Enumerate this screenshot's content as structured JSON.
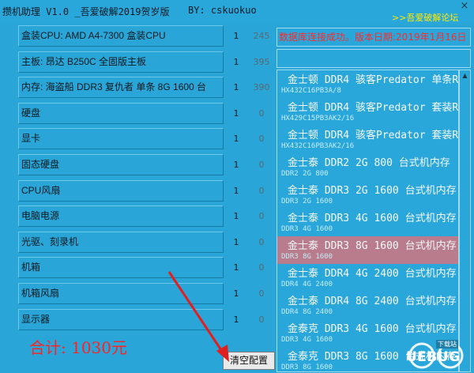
{
  "title": "攒机助理 V1.0 _吾爱破解2019贺岁版",
  "author": "BY: cskuokuo",
  "forum_link": ">>吾爱破解论坛",
  "close": "×",
  "status": "数据库连接成功。版本日期:2019年1月16日",
  "rows": [
    {
      "label": "盒装CPU: AMD A4-7300 盒装CPU",
      "qty": "1",
      "price": "245"
    },
    {
      "label": "主板: 昂达 B250C 全固版主板",
      "qty": "1",
      "price": "395"
    },
    {
      "label": "内存: 海盗船 DDR3 复仇者 单条 8G 1600 台",
      "qty": "1",
      "price": "390"
    },
    {
      "label": "硬盘",
      "qty": "1",
      "price": "0"
    },
    {
      "label": "显卡",
      "qty": "1",
      "price": "0"
    },
    {
      "label": "固态硬盘",
      "qty": "1",
      "price": "0"
    },
    {
      "label": "CPU风扇",
      "qty": "1",
      "price": "0"
    },
    {
      "label": "电脑电源",
      "qty": "1",
      "price": "0"
    },
    {
      "label": "光驱、刻录机",
      "qty": "1",
      "price": "0"
    },
    {
      "label": "机箱",
      "qty": "1",
      "price": "0"
    },
    {
      "label": "机箱风扇",
      "qty": "1",
      "price": "0"
    },
    {
      "label": "显示器",
      "qty": "1",
      "price": "0"
    }
  ],
  "list": [
    {
      "name": "金士顿 DDR4 骇客Predator 单条R",
      "model": "HX432C16PB3A/8"
    },
    {
      "name": "金士顿 DDR4 骇客Predator 套装R",
      "model": "HX429C15PB3AK2/16"
    },
    {
      "name": "金士顿 DDR4 骇客Predator 套装R",
      "model": "HX432C16PB3AK2/16"
    },
    {
      "name": "金士泰 DDR2 2G 800 台式机内存",
      "model": "DDR2 2G 800"
    },
    {
      "name": "金士泰 DDR3 2G 1600 台式机内存",
      "model": "DDR3 2G 1600"
    },
    {
      "name": "金士泰 DDR3 4G 1600 台式机内存",
      "model": "DDR3 4G 1600"
    },
    {
      "name": "金士泰 DDR3 8G 1600 台式机内存",
      "model": "DDR3 8G 1600"
    },
    {
      "name": "金士泰 DDR4 4G 2400 台式机内存",
      "model": "DDR4 4G 2400"
    },
    {
      "name": "金士泰 DDR4 8G 2400 台式机内存",
      "model": "DDR4 8G 2400"
    },
    {
      "name": "金泰克 DDR3 4G 1600 台式机内存",
      "model": "DDR3 4G 1600"
    },
    {
      "name": "金泰克 DDR3 8G 1600 台式机内存",
      "model": "DDR3 8G 1600"
    }
  ],
  "selected_index": 6,
  "total": "合计: 1030元",
  "clear_button": "清空配置",
  "watermark": {
    "text": "UEBUG",
    "tag": "下载站"
  },
  "colors": {
    "background": "#29a5d8",
    "status_text": "#ff2a2a",
    "total_text": "#ff2222",
    "forum_link": "#ffe800",
    "selected_item": "#b87c8c",
    "arrow": "#e02020"
  }
}
